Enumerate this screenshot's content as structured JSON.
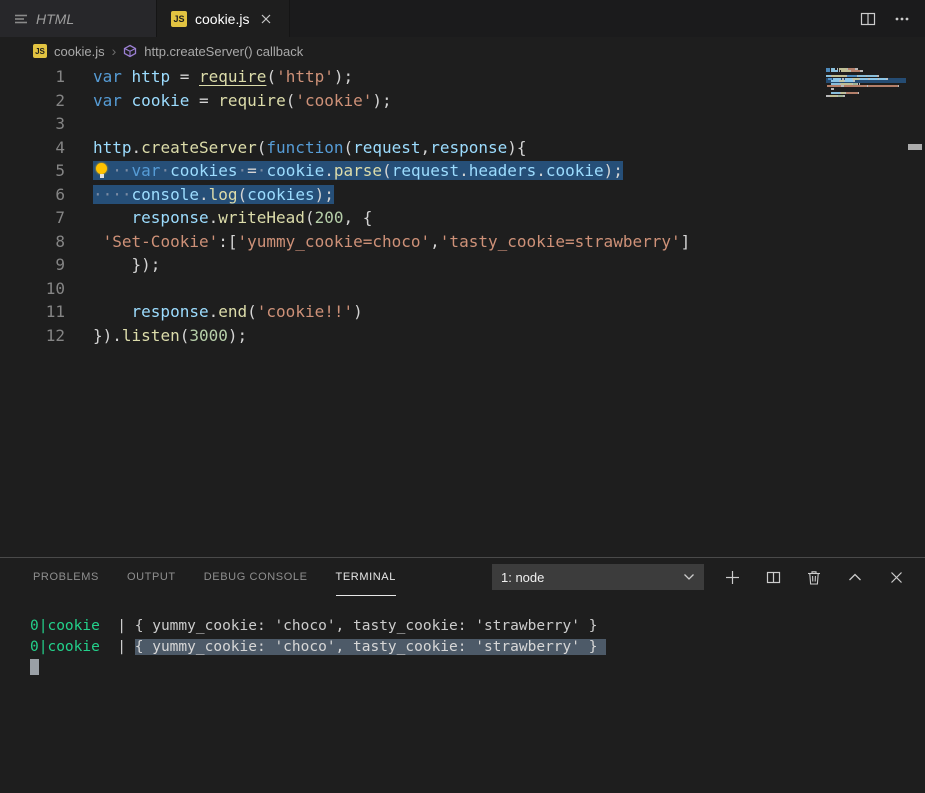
{
  "tabs": {
    "items": [
      {
        "label": "HTML",
        "preview": true,
        "active": false
      },
      {
        "label": "cookie.js",
        "preview": false,
        "active": true
      }
    ],
    "js_badge": "JS"
  },
  "breadcrumb": {
    "file": "cookie.js",
    "separator": "›",
    "symbol": "http.createServer() callback"
  },
  "editor": {
    "lines": [
      {
        "num": 1,
        "tokens": [
          [
            "kw",
            "var"
          ],
          [
            "sp",
            " "
          ],
          [
            "var",
            "http"
          ],
          [
            "sp",
            " "
          ],
          [
            "punc",
            "="
          ],
          [
            "sp",
            " "
          ],
          [
            "fn und",
            "require"
          ],
          [
            "punc",
            "("
          ],
          [
            "str",
            "'http'"
          ],
          [
            "punc",
            ")"
          ],
          [
            "punc",
            ";"
          ]
        ]
      },
      {
        "num": 2,
        "tokens": [
          [
            "kw",
            "var"
          ],
          [
            "sp",
            " "
          ],
          [
            "var",
            "cookie"
          ],
          [
            "sp",
            " "
          ],
          [
            "punc",
            "="
          ],
          [
            "sp",
            " "
          ],
          [
            "fn",
            "require"
          ],
          [
            "punc",
            "("
          ],
          [
            "str",
            "'cookie'"
          ],
          [
            "punc",
            ")"
          ],
          [
            "punc",
            ";"
          ]
        ]
      },
      {
        "num": 3,
        "tokens": []
      },
      {
        "num": 4,
        "tokens": [
          [
            "var",
            "http"
          ],
          [
            "punc",
            "."
          ],
          [
            "fn",
            "createServer"
          ],
          [
            "punc",
            "("
          ],
          [
            "kw",
            "function"
          ],
          [
            "punc",
            "("
          ],
          [
            "var",
            "request"
          ],
          [
            "punc",
            ","
          ],
          [
            "var",
            "response"
          ],
          [
            "punc",
            ")"
          ],
          [
            "punc",
            "{"
          ]
        ]
      },
      {
        "num": 5,
        "selected": true,
        "lightbulb": true,
        "tokens": [
          [
            "ws",
            "··"
          ],
          [
            "kw",
            "var"
          ],
          [
            "ws",
            "·"
          ],
          [
            "var",
            "cookies"
          ],
          [
            "ws",
            "·"
          ],
          [
            "punc",
            "="
          ],
          [
            "ws",
            "·"
          ],
          [
            "var",
            "cookie"
          ],
          [
            "punc",
            "."
          ],
          [
            "fn",
            "parse"
          ],
          [
            "punc",
            "("
          ],
          [
            "var",
            "request"
          ],
          [
            "punc",
            "."
          ],
          [
            "var",
            "headers"
          ],
          [
            "punc",
            "."
          ],
          [
            "var",
            "cookie"
          ],
          [
            "punc",
            ")"
          ],
          [
            "punc",
            ";"
          ]
        ]
      },
      {
        "num": 6,
        "selected": true,
        "tokens": [
          [
            "ws",
            "····"
          ],
          [
            "var",
            "console"
          ],
          [
            "punc",
            "."
          ],
          [
            "fn",
            "log"
          ],
          [
            "punc",
            "("
          ],
          [
            "var",
            "cookies"
          ],
          [
            "punc",
            ")"
          ],
          [
            "punc",
            ";"
          ]
        ]
      },
      {
        "num": 7,
        "tokens": [
          [
            "sp",
            "    "
          ],
          [
            "var",
            "response"
          ],
          [
            "punc",
            "."
          ],
          [
            "fn",
            "writeHead"
          ],
          [
            "punc",
            "("
          ],
          [
            "num",
            "200"
          ],
          [
            "punc",
            ","
          ],
          [
            "sp",
            " "
          ],
          [
            "punc",
            "{"
          ]
        ]
      },
      {
        "num": 8,
        "tokens": [
          [
            "sp",
            " "
          ],
          [
            "str",
            "'Set-Cookie'"
          ],
          [
            "punc",
            ":["
          ],
          [
            "str",
            "'yummy_cookie=choco'"
          ],
          [
            "punc",
            ","
          ],
          [
            "str",
            "'tasty_cookie=strawberry'"
          ],
          [
            "punc",
            "]"
          ]
        ]
      },
      {
        "num": 9,
        "tokens": [
          [
            "sp",
            "    "
          ],
          [
            "punc",
            "});"
          ]
        ]
      },
      {
        "num": 10,
        "tokens": []
      },
      {
        "num": 11,
        "tokens": [
          [
            "sp",
            "    "
          ],
          [
            "var",
            "response"
          ],
          [
            "punc",
            "."
          ],
          [
            "fn",
            "end"
          ],
          [
            "punc",
            "("
          ],
          [
            "str",
            "'cookie!!'"
          ],
          [
            "punc",
            ")"
          ]
        ]
      },
      {
        "num": 12,
        "tokens": [
          [
            "punc",
            "})."
          ],
          [
            "fn",
            "listen"
          ],
          [
            "punc",
            "("
          ],
          [
            "num",
            "3000"
          ],
          [
            "punc",
            ")"
          ],
          [
            "punc",
            ";"
          ]
        ]
      }
    ]
  },
  "panel": {
    "tabs": [
      {
        "label": "PROBLEMS",
        "active": false
      },
      {
        "label": "OUTPUT",
        "active": false
      },
      {
        "label": "DEBUG CONSOLE",
        "active": false
      },
      {
        "label": "TERMINAL",
        "active": true
      }
    ],
    "terminal_select": {
      "value": "1: node"
    },
    "terminal": {
      "lines": [
        {
          "tokens": [
            [
              "green",
              "0|cookie"
            ],
            [
              "plain",
              "  | "
            ],
            [
              "plain",
              "{ yummy_cookie: 'choco', tasty_cookie: 'strawberry' }"
            ]
          ]
        },
        {
          "tokens": [
            [
              "green",
              "0|cookie"
            ],
            [
              "plain",
              "  | "
            ],
            [
              "sel",
              "{ yummy_cookie: 'choco', tasty_cookie: 'strawberry' } "
            ]
          ]
        },
        {
          "cursor": true,
          "tokens": []
        }
      ]
    }
  },
  "colors": {
    "selection": "#264f78",
    "terminal_selection": "#4d5a68",
    "terminal_green": "#23d18b",
    "keyword": "#569cd6",
    "function": "#dcdcaa",
    "variable": "#9cdcfe",
    "string": "#ce9178",
    "number": "#b5cea8",
    "js_badge_bg": "#e2c341",
    "lightbulb": "#ffc200"
  },
  "icons": [
    "file-icon",
    "js-file-icon",
    "close-icon",
    "split-editor-icon",
    "more-actions-icon",
    "breadcrumb-chevron-icon",
    "symbol-method-icon",
    "chevron-down-icon",
    "new-terminal-icon",
    "split-terminal-icon",
    "trash-icon",
    "chevron-up-icon",
    "lightbulb-icon",
    "terminal-cursor"
  ]
}
